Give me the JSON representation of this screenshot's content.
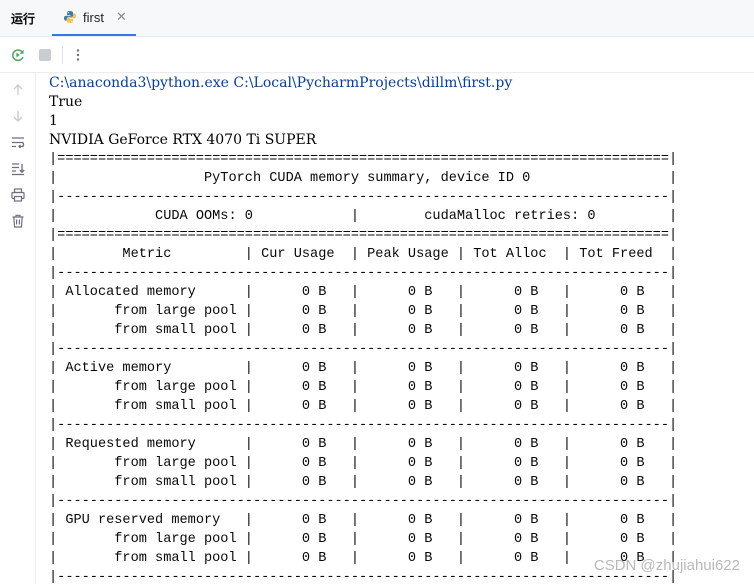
{
  "run_panel": {
    "title": "运行",
    "tab": {
      "label": "first",
      "close_glyph": "✕",
      "icon": "python-icon"
    }
  },
  "toolbar": {
    "buttons": [
      {
        "icon": "rerun-icon",
        "color": "#55a76a"
      },
      {
        "icon": "stop-icon",
        "color": "#c9ccd3"
      },
      {
        "icon": "more-vertical-icon",
        "color": "#6c707e"
      }
    ]
  },
  "sidebar": {
    "buttons": [
      "arrow-up-icon",
      "arrow-down-icon",
      "soft-wrap-icon",
      "scroll-to-end-icon",
      "print-icon",
      "trash-icon"
    ]
  },
  "console": {
    "lines": [
      "C:\\anaconda3\\python.exe C:\\Local\\PycharmProjects\\dillm\\first.py",
      "True",
      "1",
      "NVIDIA GeForce RTX 4070 Ti SUPER"
    ],
    "table_lines": [
      "|===========================================================================|",
      "|                  PyTorch CUDA memory summary, device ID 0                 |",
      "|---------------------------------------------------------------------------|",
      "|            CUDA OOMs: 0            |        cudaMalloc retries: 0         |",
      "|===========================================================================|",
      "|        Metric         | Cur Usage  | Peak Usage | Tot Alloc  | Tot Freed  |",
      "|---------------------------------------------------------------------------|",
      "| Allocated memory      |      0 B   |      0 B   |      0 B   |      0 B   |",
      "|       from large pool |      0 B   |      0 B   |      0 B   |      0 B   |",
      "|       from small pool |      0 B   |      0 B   |      0 B   |      0 B   |",
      "|---------------------------------------------------------------------------|",
      "| Active memory         |      0 B   |      0 B   |      0 B   |      0 B   |",
      "|       from large pool |      0 B   |      0 B   |      0 B   |      0 B   |",
      "|       from small pool |      0 B   |      0 B   |      0 B   |      0 B   |",
      "|---------------------------------------------------------------------------|",
      "| Requested memory      |      0 B   |      0 B   |      0 B   |      0 B   |",
      "|       from large pool |      0 B   |      0 B   |      0 B   |      0 B   |",
      "|       from small pool |      0 B   |      0 B   |      0 B   |      0 B   |",
      "|---------------------------------------------------------------------------|",
      "| GPU reserved memory   |      0 B   |      0 B   |      0 B   |      0 B   |",
      "|       from large pool |      0 B   |      0 B   |      0 B   |      0 B   |",
      "|       from small pool |      0 B   |      0 B   |      0 B   |      0 B   |",
      "|---------------------------------------------------------------------------|"
    ]
  },
  "watermark": "CSDN @zhujiahui622"
}
